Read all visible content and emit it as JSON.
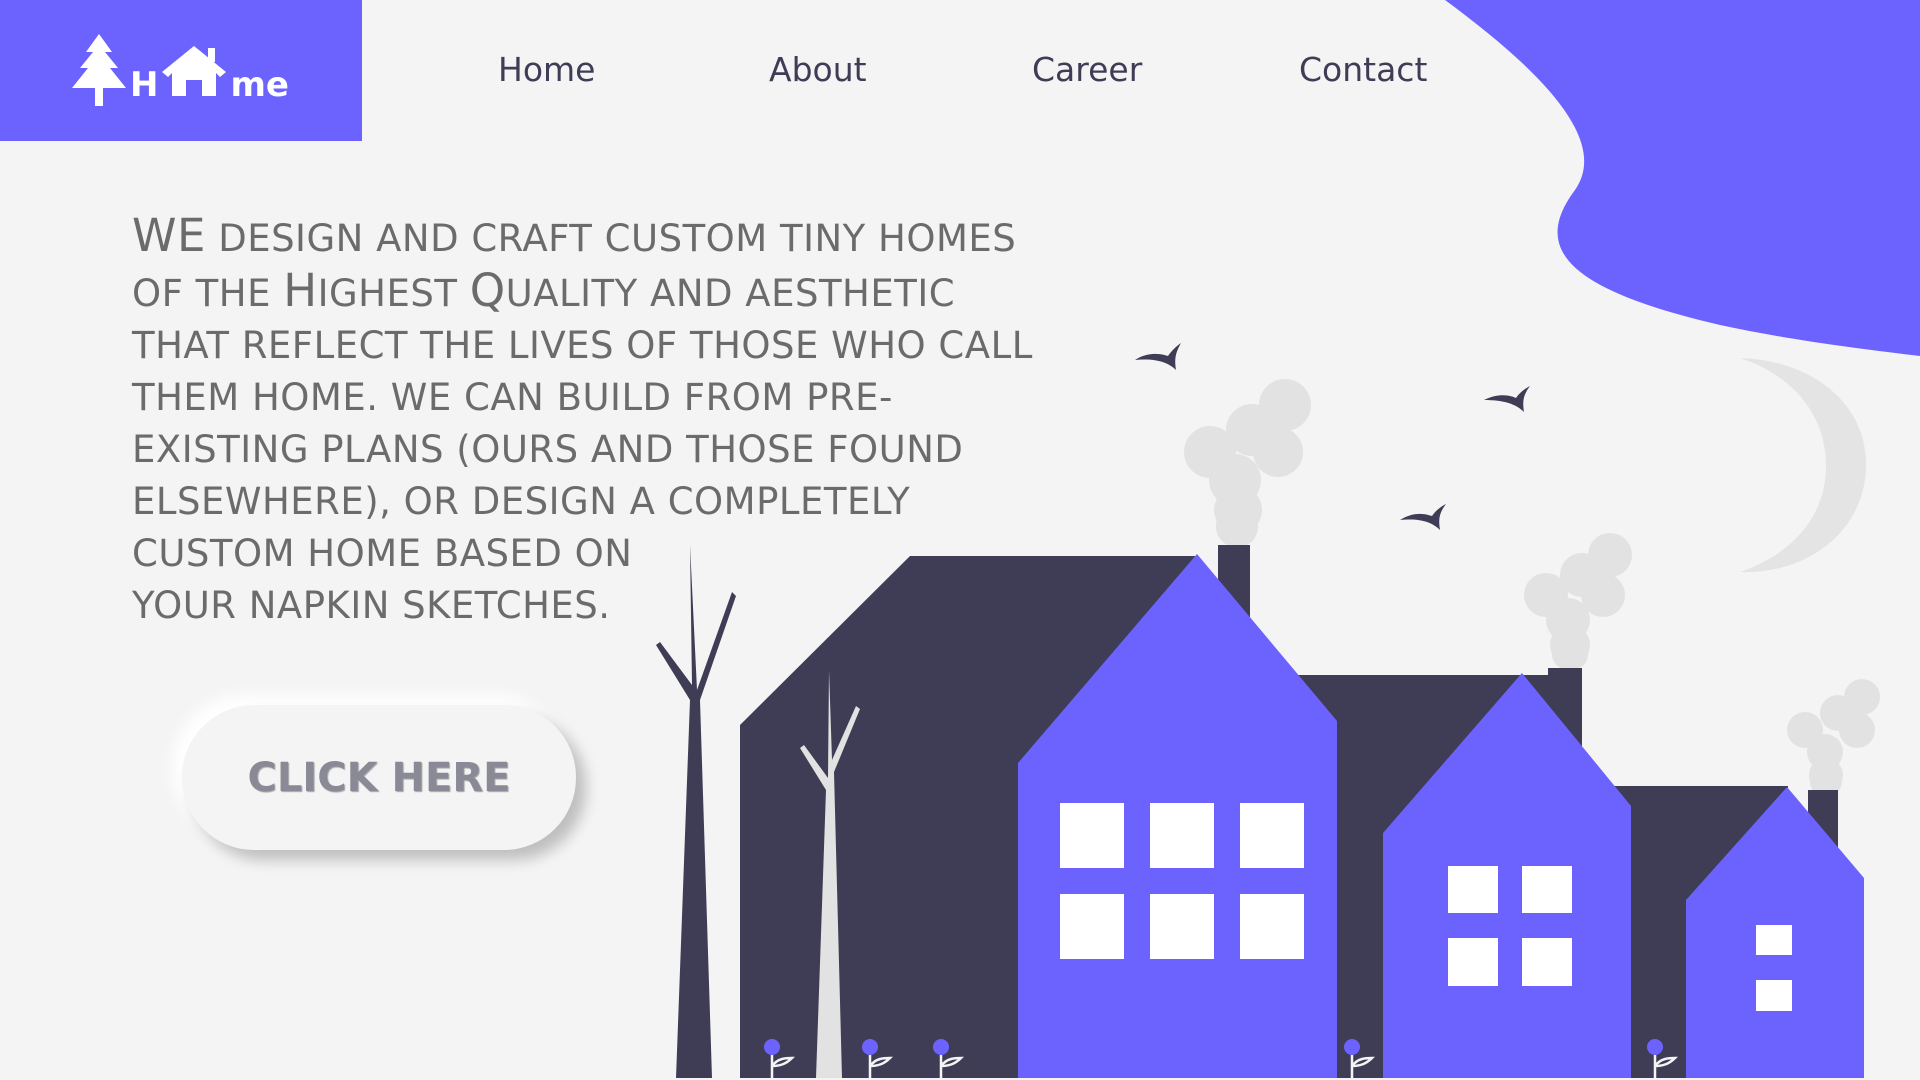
{
  "brand": {
    "logo_letter_h": "H",
    "logo_letters_me": "me",
    "accent_color": "#6c63ff",
    "dark_color": "#3f3d56"
  },
  "nav": {
    "items": [
      {
        "label": "Home"
      },
      {
        "label": "About"
      },
      {
        "label": "Career"
      },
      {
        "label": "Contact"
      }
    ]
  },
  "hero": {
    "lines": [
      {
        "big": "WE",
        "rest": " DESIGN AND CRAFT CUSTOM TINY HOMES"
      },
      {
        "pre": "OF THE ",
        "big1": "H",
        "mid": "IGHEST ",
        "big2": "Q",
        "post": "UALITY AND AESTHETIC"
      },
      {
        "text": "THAT REFLECT THE LIVES OF THOSE WHO CALL"
      },
      {
        "text": "THEM HOME. WE CAN BUILD FROM PRE-"
      },
      {
        "text": "EXISTING PLANS (OURS AND THOSE FOUND"
      },
      {
        "text": "ELSEWHERE), OR DESIGN A COMPLETELY"
      },
      {
        "text": "CUSTOM HOME BASED ON"
      },
      {
        "text": "YOUR NAPKIN SKETCHES."
      }
    ]
  },
  "cta": {
    "label": "CLICK HERE"
  },
  "illustration": {
    "icons": [
      "tree-icon",
      "house-icon",
      "moon-icon",
      "bird-icon",
      "smoke-cloud-icon",
      "flower-icon"
    ]
  }
}
